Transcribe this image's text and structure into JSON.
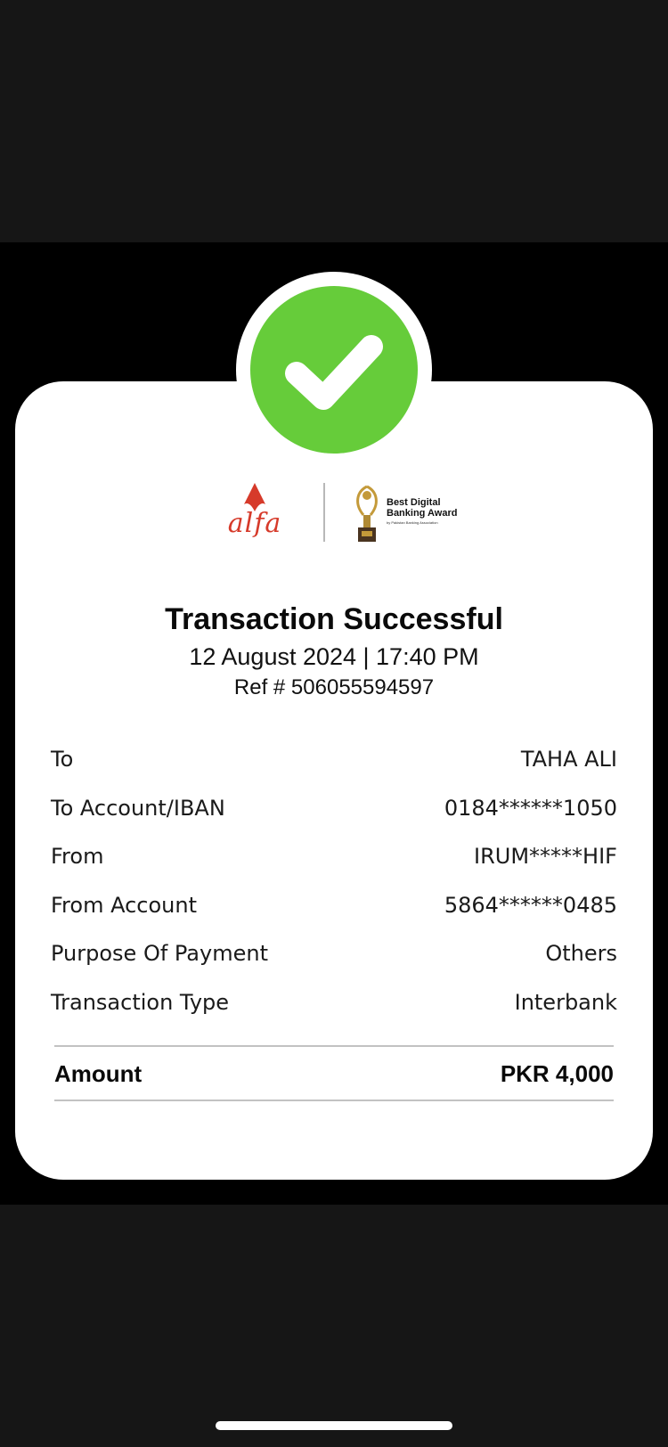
{
  "brand": {
    "logo_text": "alfa",
    "award_title": "Best Digital\nBanking Award",
    "award_subtitle": "by Pakistan Banking Association"
  },
  "receipt": {
    "title": "Transaction Successful",
    "datetime": "12 August 2024 | 17:40 PM",
    "reference": "Ref # 506055594597",
    "rows": [
      {
        "label": "To",
        "value": "TAHA ALI"
      },
      {
        "label": "To Account/IBAN",
        "value": "0184******1050"
      },
      {
        "label": "From",
        "value": "IRUM*****HIF"
      },
      {
        "label": "From Account",
        "value": "5864******0485"
      },
      {
        "label": "Purpose Of Payment",
        "value": "Others"
      },
      {
        "label": "Transaction Type",
        "value": "Interbank"
      }
    ],
    "amount_label": "Amount",
    "amount_value": "PKR 4,000"
  },
  "icons": {
    "status": "check-icon",
    "brand_mark": "alfa-logo",
    "award": "trophy-icon"
  },
  "colors": {
    "success": "#66cc3a",
    "brand": "#d63a2a",
    "card": "#ffffff",
    "background": "#000000"
  }
}
